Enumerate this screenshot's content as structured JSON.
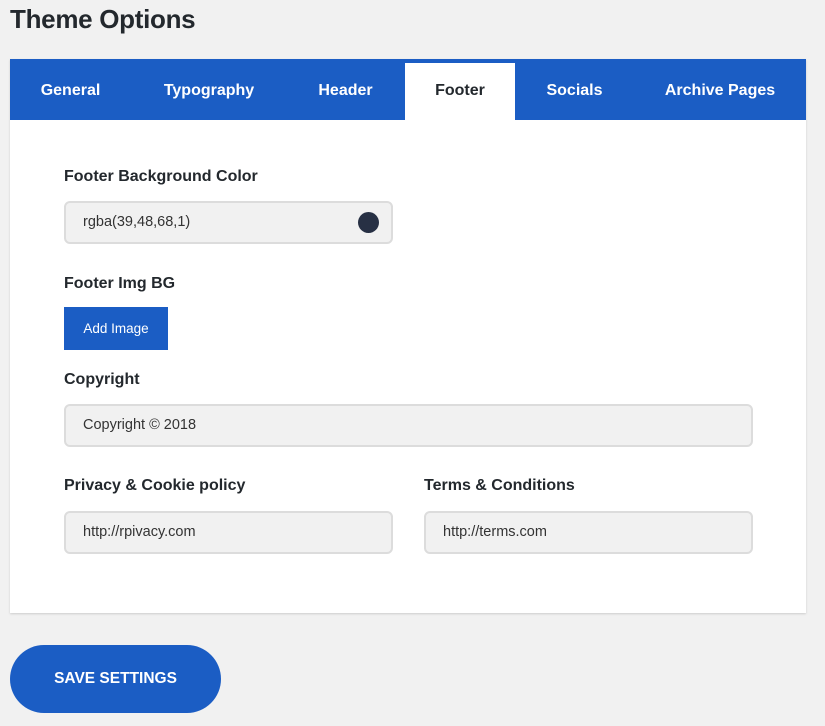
{
  "page": {
    "title": "Theme Options"
  },
  "tabs": [
    {
      "label": "General"
    },
    {
      "label": "Typography"
    },
    {
      "label": "Header"
    },
    {
      "label": "Footer"
    },
    {
      "label": "Socials"
    },
    {
      "label": "Archive Pages"
    }
  ],
  "active_tab": "Footer",
  "footer": {
    "bg_color": {
      "label": "Footer Background Color",
      "value": "rgba(39,48,68,1)",
      "swatch_color": "#273044"
    },
    "img_bg": {
      "label": "Footer Img BG",
      "button_label": "Add Image"
    },
    "copyright": {
      "label": "Copyright",
      "value": "Copyright © 2018"
    },
    "privacy": {
      "label": "Privacy & Cookie policy",
      "value": "http://rpivacy.com"
    },
    "terms": {
      "label": "Terms & Conditions",
      "value": "http://terms.com"
    }
  },
  "actions": {
    "save_label": "SAVE SETTINGS"
  },
  "colors": {
    "accent": "#1b5dc4",
    "background": "#f1f1f1",
    "panel": "#ffffff"
  }
}
